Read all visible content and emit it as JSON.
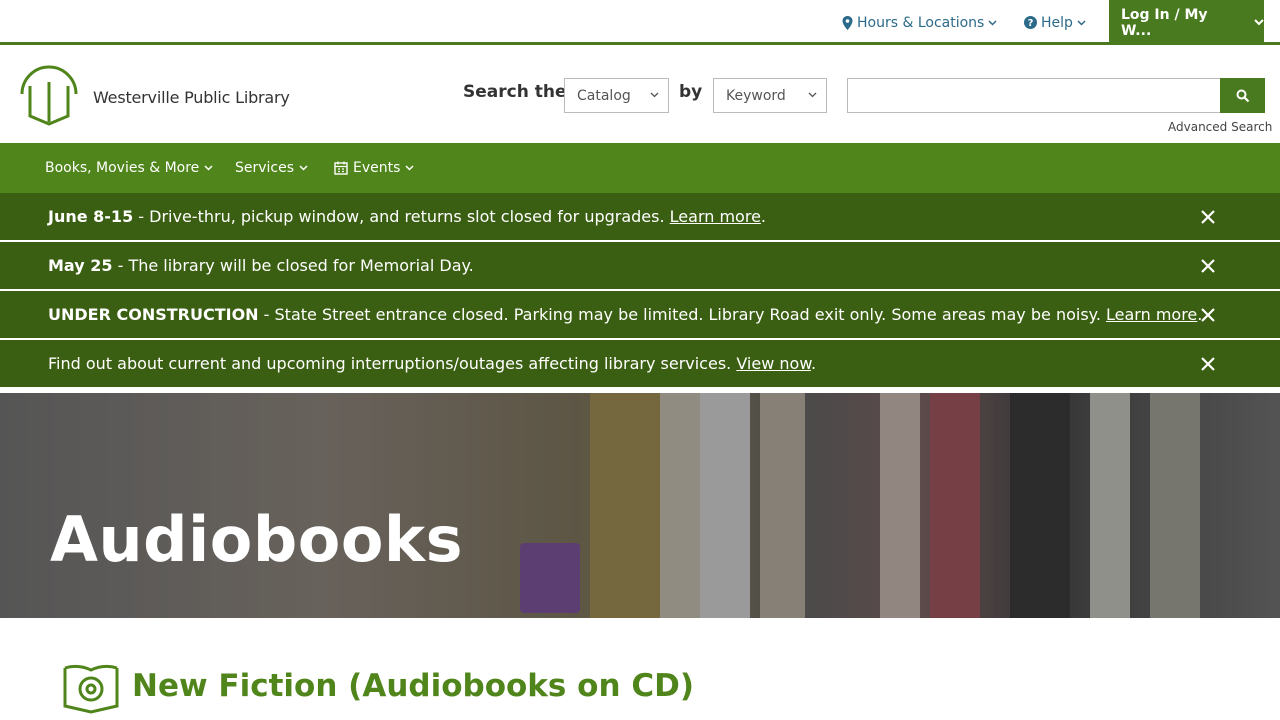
{
  "topbar": {
    "hours_label": "Hours & Locations",
    "help_label": "Help",
    "login_label": "Log In / My W..."
  },
  "header": {
    "logo_text": "Westerville Public Library",
    "search_the": "Search the",
    "search_by": "by",
    "scope_value": "Catalog",
    "field_value": "Keyword",
    "search_value": "",
    "advanced_search": "Advanced Search"
  },
  "nav": {
    "items": [
      {
        "label": "Books, Movies & More"
      },
      {
        "label": "Services"
      },
      {
        "label": "Events"
      }
    ]
  },
  "alerts": [
    {
      "bold": "June 8-15",
      "text": " - Drive-thru, pickup window, and returns slot closed for upgrades. ",
      "link": "Learn more",
      "tail": "."
    },
    {
      "bold": "May 25",
      "text": " - The library will be closed for Memorial Day.",
      "link": "",
      "tail": ""
    },
    {
      "bold": "UNDER CONSTRUCTION",
      "text": " - State Street entrance closed. Parking may be limited. Library Road exit only. Some areas may be noisy. ",
      "link": "Learn more",
      "tail": "."
    },
    {
      "bold": "",
      "text": "Find out about current and upcoming interruptions/outages affecting library services. ",
      "link": "View now",
      "tail": "."
    }
  ],
  "hero": {
    "title": "Audiobooks"
  },
  "section": {
    "title": "New Fiction (Audiobooks on CD)"
  },
  "colors": {
    "brand_green": "#4f851a",
    "alert_green": "#3b5f12",
    "link_blue": "#2c6a8a"
  }
}
